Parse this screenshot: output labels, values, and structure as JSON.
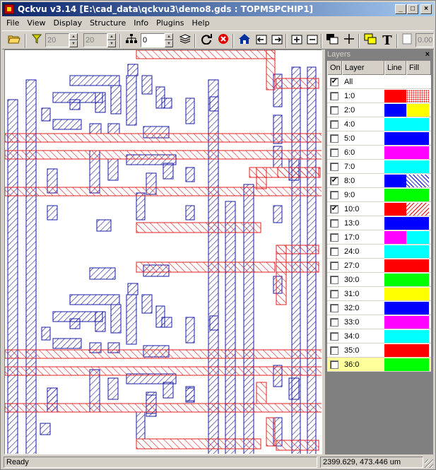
{
  "window": {
    "title": "Qckvu v3.14 [E:\\cad_data\\qckvu3\\demo8.gds : TOPMSPCHIP1]",
    "controls": {
      "minimize": "_",
      "maximize": "□",
      "close": "×"
    }
  },
  "menu": [
    "File",
    "View",
    "Display",
    "Structure",
    "Info",
    "Plugins",
    "Help"
  ],
  "toolbar": {
    "spin1_value": "20",
    "spin2_value": "20",
    "spin3_value": "0",
    "partial_field": "0.00",
    "text_tool_label": "T"
  },
  "layers_panel": {
    "title": "Layers",
    "close_label": "×",
    "headers": {
      "on": "On",
      "layer": "Layer",
      "line": "Line",
      "fill": "Fill"
    },
    "rows": [
      {
        "name": "All",
        "on": true,
        "line": "#ffffff",
        "fill": "#ffffff",
        "fill_style": "none"
      },
      {
        "name": "1:0",
        "on": false,
        "line": "#ff0000",
        "fill": "#ff0000",
        "fill_style": "dots"
      },
      {
        "name": "2:0",
        "on": false,
        "line": "#0000ff",
        "fill": "#ffff00",
        "fill_style": "solid"
      },
      {
        "name": "4:0",
        "on": false,
        "line": "#00ffff",
        "fill": "#00ffff",
        "fill_style": "solid"
      },
      {
        "name": "5:0",
        "on": false,
        "line": "#0000ff",
        "fill": "#0000ff",
        "fill_style": "solid"
      },
      {
        "name": "6:0",
        "on": false,
        "line": "#ff00ff",
        "fill": "#ff00ff",
        "fill_style": "solid"
      },
      {
        "name": "7:0",
        "on": false,
        "line": "#00ffff",
        "fill": "#00ffff",
        "fill_style": "solid"
      },
      {
        "name": "8:0",
        "on": true,
        "line": "#0000ff",
        "fill": "#0000ff",
        "fill_style": "hatch-blue"
      },
      {
        "name": "9:0",
        "on": false,
        "line": "#00ff00",
        "fill": "#00ff00",
        "fill_style": "solid"
      },
      {
        "name": "10:0",
        "on": true,
        "line": "#ff0000",
        "fill": "#ff0000",
        "fill_style": "hatch-red"
      },
      {
        "name": "13:0",
        "on": false,
        "line": "#0000ff",
        "fill": "#0000ff",
        "fill_style": "solid"
      },
      {
        "name": "17:0",
        "on": false,
        "line": "#ff00ff",
        "fill": "#00ffff",
        "fill_style": "solid"
      },
      {
        "name": "24:0",
        "on": false,
        "line": "#00ffff",
        "fill": "#00ffff",
        "fill_style": "solid"
      },
      {
        "name": "27:0",
        "on": false,
        "line": "#ff0000",
        "fill": "#ff0000",
        "fill_style": "solid"
      },
      {
        "name": "30:0",
        "on": false,
        "line": "#00ff00",
        "fill": "#00ff00",
        "fill_style": "solid"
      },
      {
        "name": "31:0",
        "on": false,
        "line": "#ffff00",
        "fill": "#ffff00",
        "fill_style": "solid"
      },
      {
        "name": "32:0",
        "on": false,
        "line": "#0000ff",
        "fill": "#0000ff",
        "fill_style": "solid"
      },
      {
        "name": "33:0",
        "on": false,
        "line": "#ff00ff",
        "fill": "#ff00ff",
        "fill_style": "solid"
      },
      {
        "name": "34:0",
        "on": false,
        "line": "#00ffff",
        "fill": "#00ffff",
        "fill_style": "solid"
      },
      {
        "name": "35:0",
        "on": false,
        "line": "#ff0000",
        "fill": "#ff0000",
        "fill_style": "solid"
      },
      {
        "name": "36:0",
        "on": false,
        "line": "#00ff00",
        "fill": "#00ff00",
        "fill_style": "solid",
        "selected": true
      }
    ]
  },
  "status": {
    "left": "Ready",
    "coords": "2399.629, 473.446 um"
  },
  "colors": {
    "metal_blue": "#1a1aa0",
    "poly_red": "#e02020",
    "titlebar_start": "#0a246a",
    "titlebar_end": "#a6caf0"
  }
}
